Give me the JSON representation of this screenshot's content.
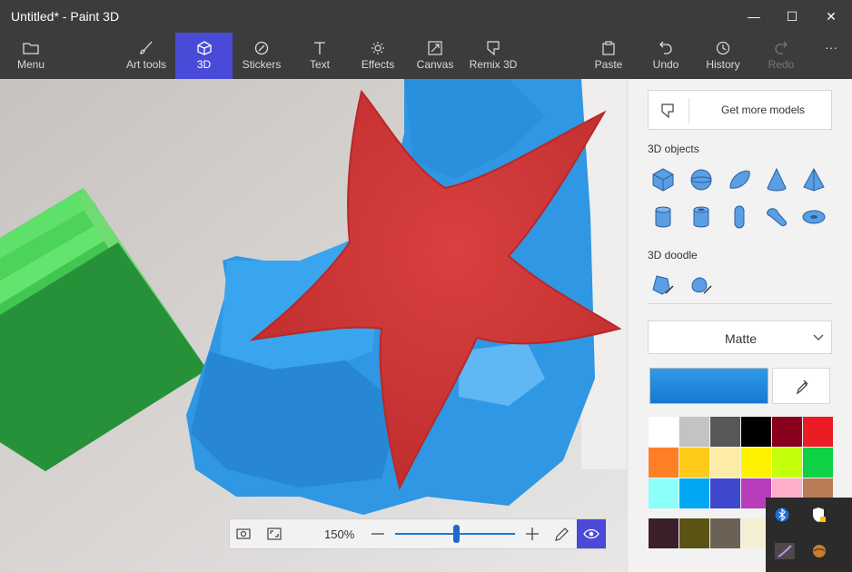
{
  "window": {
    "title": "Untitled* - Paint 3D",
    "controls": {
      "minimize": "—",
      "maximize": "☐",
      "close": "✕"
    }
  },
  "toolbar": {
    "menu": "Menu",
    "art_tools": "Art tools",
    "three_d": "3D",
    "stickers": "Stickers",
    "text": "Text",
    "effects": "Effects",
    "canvas": "Canvas",
    "remix_3d": "Remix 3D",
    "paste": "Paste",
    "undo": "Undo",
    "history": "History",
    "redo": "Redo",
    "more": "···",
    "active_tool": "3D"
  },
  "zoom": {
    "value": "150%",
    "level": 0.51
  },
  "panel": {
    "get_more_models": "Get more models",
    "objects_title": "3D objects",
    "objects_row1": [
      "cube-icon",
      "sphere-icon",
      "hemisphere-icon",
      "cone-icon",
      "pyramid-icon"
    ],
    "objects_row2": [
      "cylinder-icon",
      "tube-icon",
      "capsule-icon",
      "donut-icon",
      "torus-icon"
    ],
    "doodle_title": "3D doodle",
    "doodles": [
      "sharp-edge-doodle-icon",
      "soft-edge-doodle-icon"
    ],
    "material": "Matte",
    "current_color": "#1f88dc",
    "palette": [
      [
        "#ffffff",
        "#c3c3c3",
        "#585858",
        "#000000",
        "#88001b",
        "#ec1c24"
      ],
      [
        "#ff7f27",
        "#ffca18",
        "#fdeca6",
        "#fff200",
        "#c4ff0e",
        "#0ed145"
      ],
      [
        "#8cfffb",
        "#00a8f3",
        "#3f48cc",
        "#b83dba",
        "#ffaec8",
        "#b97a56"
      ],
      [
        "#3b1f2b",
        "#5b5313",
        "#6b6255",
        "#f3efd2",
        "#f2f2f2",
        "#f2f2f2"
      ]
    ]
  },
  "colors": {
    "titlebar": "#3c3c3c",
    "accent": "#4a4ad8",
    "star": "#d63a3a",
    "blue_shape": "#2f97e4",
    "green_box": "#33b34a"
  }
}
